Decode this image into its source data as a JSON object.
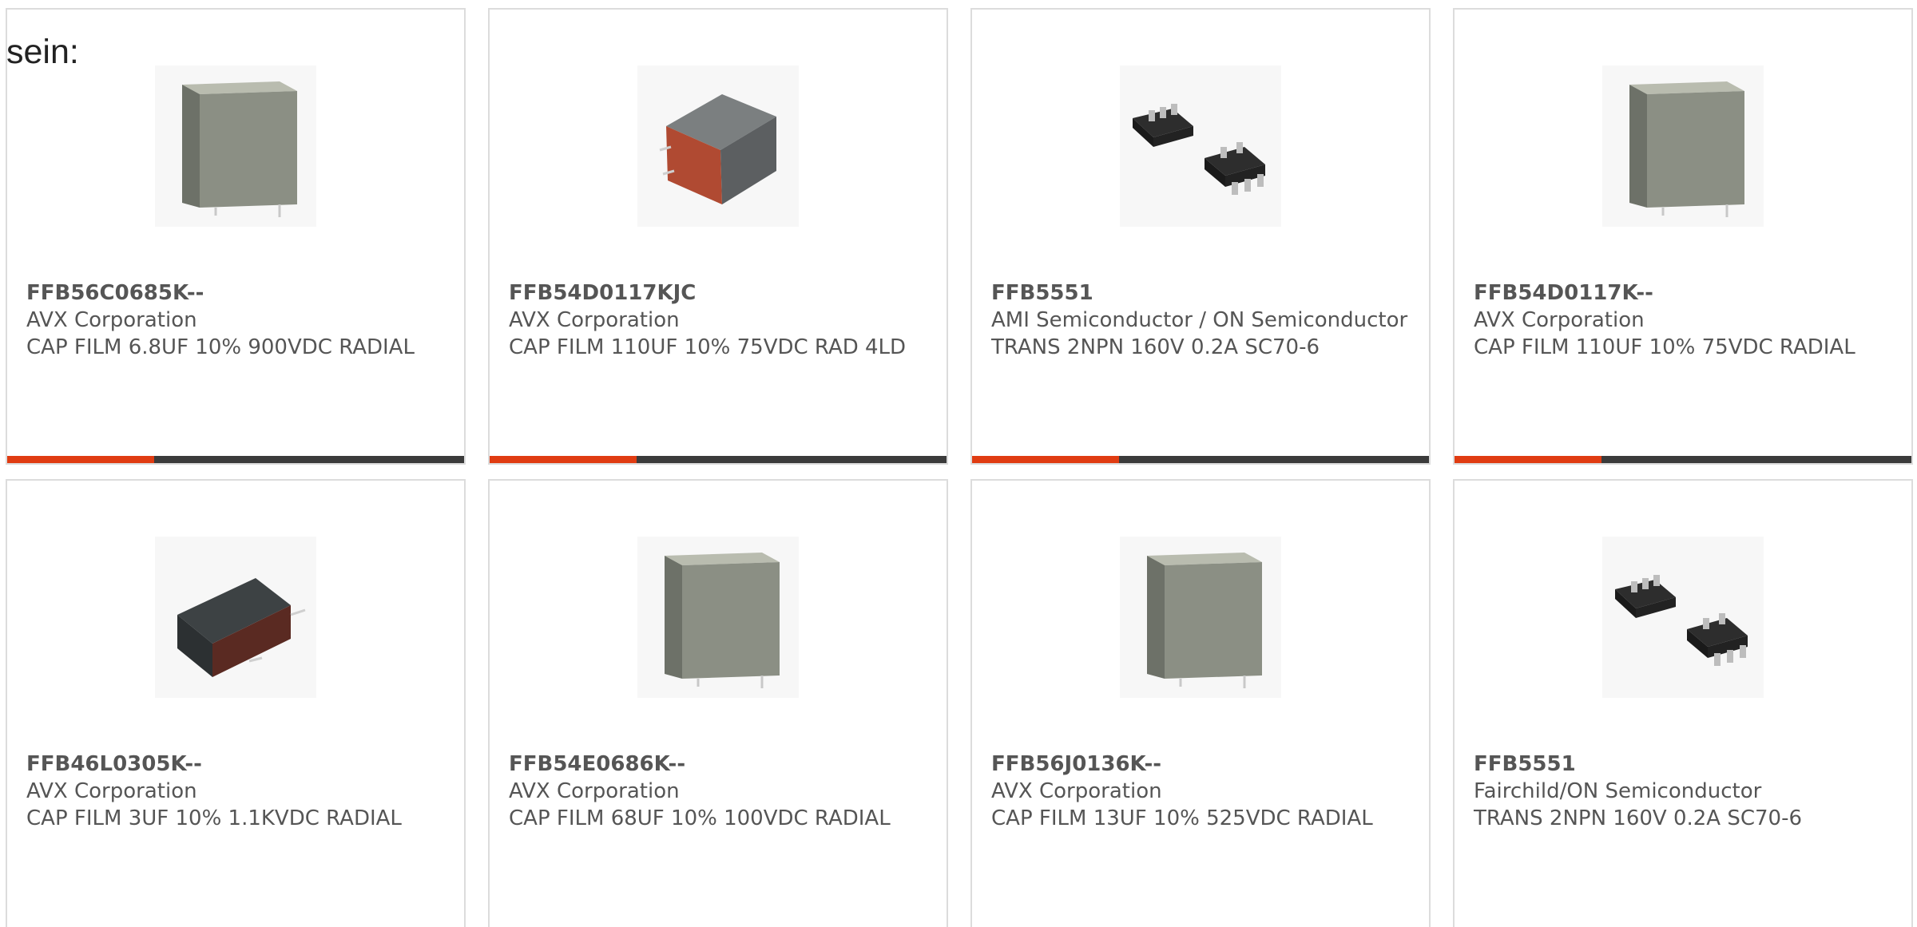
{
  "intro_text": "sein:",
  "colors": {
    "accent": "#e03c12",
    "bar_dark": "#3b3b3b",
    "card_border": "#dcdcdc",
    "text": "#555555"
  },
  "products": [
    {
      "part_number": "FFB56C0685K--",
      "manufacturer": "AVX Corporation",
      "description": "CAP FILM 6.8UF 10% 900VDC RADIAL",
      "image_icon": "film-capacitor-box-icon"
    },
    {
      "part_number": "FFB54D0117KJC",
      "manufacturer": "AVX Corporation",
      "description": "CAP FILM 110UF 10% 75VDC RAD 4LD",
      "image_icon": "film-capacitor-4lead-icon"
    },
    {
      "part_number": "FFB5551",
      "manufacturer": "AMI Semiconductor / ON Semiconductor",
      "description": "TRANS 2NPN 160V 0.2A SC70-6",
      "image_icon": "sc70-transistor-icon"
    },
    {
      "part_number": "FFB54D0117K--",
      "manufacturer": "AVX Corporation",
      "description": "CAP FILM 110UF 10% 75VDC RADIAL",
      "image_icon": "film-capacitor-box-icon"
    },
    {
      "part_number": "FFB46L0305K--",
      "manufacturer": "AVX Corporation",
      "description": "CAP FILM 3UF 10% 1.1KVDC RADIAL",
      "image_icon": "film-capacitor-dark-icon"
    },
    {
      "part_number": "FFB54E0686K--",
      "manufacturer": "AVX Corporation",
      "description": "CAP FILM 68UF 10% 100VDC RADIAL",
      "image_icon": "film-capacitor-box-icon"
    },
    {
      "part_number": "FFB56J0136K--",
      "manufacturer": "AVX Corporation",
      "description": "CAP FILM 13UF 10% 525VDC RADIAL",
      "image_icon": "film-capacitor-box-icon"
    },
    {
      "part_number": "FFB5551",
      "manufacturer": "Fairchild/ON Semiconductor",
      "description": "TRANS 2NPN 160V 0.2A SC70-6",
      "image_icon": "sc70-transistor-icon"
    }
  ]
}
